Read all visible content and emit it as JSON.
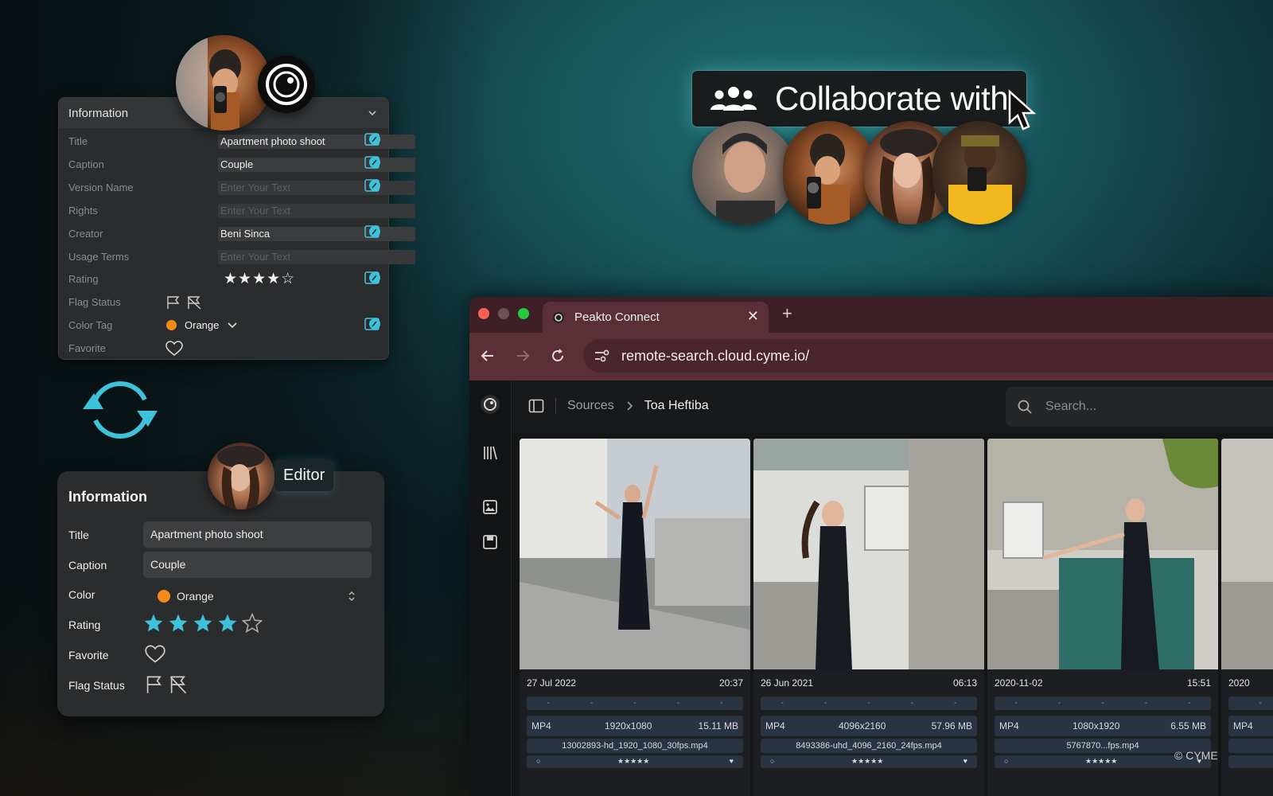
{
  "small_panel": {
    "title": "Information",
    "rows": [
      {
        "label": "Title",
        "value": "Apartment photo shoot",
        "placeholder": false
      },
      {
        "label": "Caption",
        "value": "Couple",
        "placeholder": false
      },
      {
        "label": "Version Name",
        "value": "Enter Your Text",
        "placeholder": true
      },
      {
        "label": "Rights",
        "value": "Enter Your Text",
        "placeholder": true
      },
      {
        "label": "Creator",
        "value": "Beni Sinca",
        "placeholder": false
      },
      {
        "label": "Usage Terms",
        "value": "Enter Your Text",
        "placeholder": true
      },
      {
        "label": "Rating",
        "value": "★★★★☆"
      },
      {
        "label": "Flag Status"
      },
      {
        "label": "Color Tag",
        "value": "Orange"
      },
      {
        "label": "Favorite"
      }
    ],
    "rating": 4,
    "rating_max": 5
  },
  "big_panel": {
    "title": "Information",
    "editor_label": "Editor",
    "labels": {
      "title": "Title",
      "caption": "Caption",
      "color": "Color",
      "rating": "Rating",
      "favorite": "Favorite",
      "flag_status": "Flag Status"
    },
    "values": {
      "title": "Apartment photo shoot",
      "caption": "Couple",
      "color": "Orange"
    },
    "rating": 4,
    "rating_max": 5
  },
  "collaborate": {
    "label": "Collaborate with"
  },
  "browser": {
    "tab_title": "Peakto Connect",
    "close_glyph": "✕",
    "new_tab_glyph": "+",
    "url": "remote-search.cloud.cyme.io/",
    "breadcrumb": {
      "root": "Sources",
      "current": "Toa Heftiba"
    },
    "search_placeholder": "Search..."
  },
  "cards": [
    {
      "date": "27 Jul 2022",
      "time": "20:37",
      "format": "MP4",
      "resolution": "1920x1080",
      "size": "15.11 MB",
      "filename": "13002893-hd_1920_1080_30fps.mp4",
      "stars": "★★★★★"
    },
    {
      "date": "26 Jun 2021",
      "time": "06:13",
      "format": "MP4",
      "resolution": "4096x2160",
      "size": "57.96 MB",
      "filename": "8493386-uhd_4096_2160_24fps.mp4",
      "stars": "★★★★★"
    },
    {
      "date": "2020-11-02",
      "time": "15:51",
      "format": "MP4",
      "resolution": "1080x1920",
      "size": "6.55 MB",
      "filename": "5767870...fps.mp4",
      "stars": "★★★★★"
    },
    {
      "date": "2020",
      "format": "MP4"
    }
  ],
  "watermark": "© CYME",
  "colors": {
    "accent_teal": "#3fc1d9",
    "orange_tag": "#f5891a",
    "browser_chrome": "#5b2f38"
  }
}
